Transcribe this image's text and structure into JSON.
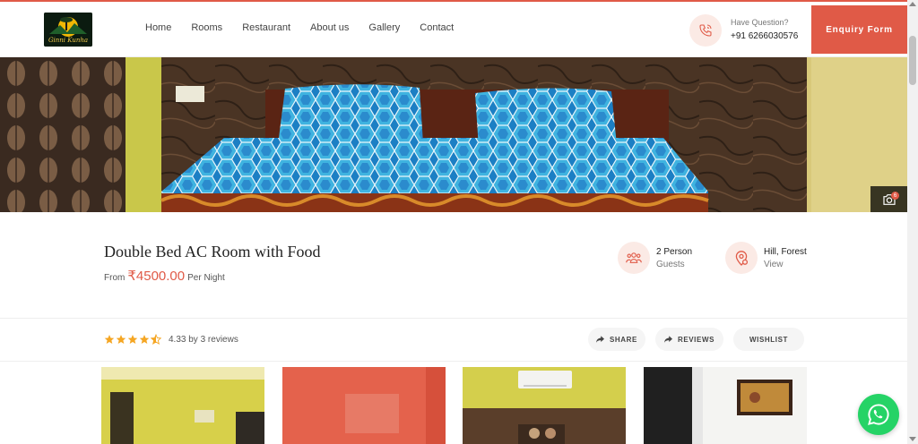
{
  "brand": {
    "logo_text": "Ginni Kunha",
    "logo_icon": "sunset-tree-logo"
  },
  "nav": {
    "items": [
      "Home",
      "Rooms",
      "Restaurant",
      "About us",
      "Gallery",
      "Contact"
    ]
  },
  "contact": {
    "question": "Have Question?",
    "phone": "+91 6266030576",
    "icon": "phone-icon"
  },
  "enquiry": {
    "label": "Enquiry Form"
  },
  "hero": {
    "gallery_count": "6",
    "gallery_icon": "camera-icon"
  },
  "room": {
    "title": "Double Bed AC Room with Food",
    "price_prefix": "From",
    "price": "₹4500.00",
    "price_suffix": "Per Night"
  },
  "features": [
    {
      "icon": "guests-icon",
      "top": "2 Person",
      "bottom": "Guests"
    },
    {
      "icon": "location-icon",
      "top": "Hill, Forest",
      "bottom": "View"
    }
  ],
  "rating": {
    "value": 4.33,
    "stars_full": 4,
    "stars_half": 1,
    "text": "4.33 by 3 reviews"
  },
  "actions": [
    {
      "label": "SHARE",
      "icon": "share-icon"
    },
    {
      "label": "REVIEWS",
      "icon": "share-icon"
    },
    {
      "label": "WISHLIST",
      "icon": ""
    }
  ],
  "colors": {
    "accent": "#e05a47",
    "accent_light": "#fbeae5",
    "star": "#f5a623",
    "whatsapp": "#25d366"
  },
  "widgets": {
    "whatsapp_icon": "whatsapp-icon"
  }
}
